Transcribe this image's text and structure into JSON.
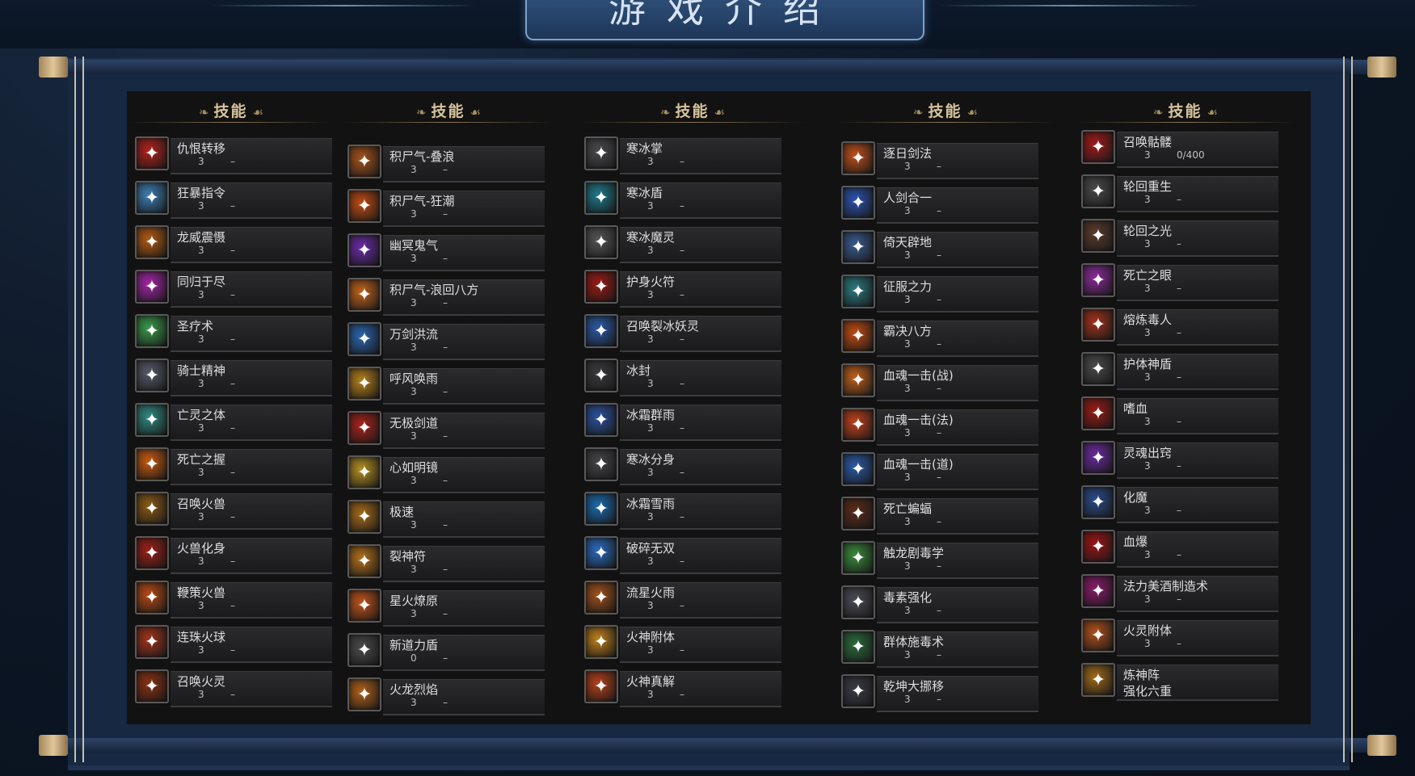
{
  "title": "游戏介绍",
  "column_header": "技能",
  "columns": [
    {
      "skills": [
        {
          "name": "仇恨转移",
          "level": "3",
          "progress": "–",
          "icon": "hatred-shift-icon",
          "color": "#b3201b"
        },
        {
          "name": "狂暴指令",
          "level": "3",
          "progress": "–",
          "icon": "berserk-command-icon",
          "color": "#3d7fb5"
        },
        {
          "name": "龙威震慑",
          "level": "3",
          "progress": "–",
          "icon": "dragon-roar-icon",
          "color": "#b35a12"
        },
        {
          "name": "同归于尽",
          "level": "3",
          "progress": "–",
          "icon": "mutual-destruction-icon",
          "color": "#a424a6"
        },
        {
          "name": "圣疗术",
          "level": "3",
          "progress": "–",
          "icon": "holy-heal-icon",
          "color": "#3a9a4a"
        },
        {
          "name": "骑士精神",
          "level": "3",
          "progress": "–",
          "icon": "knight-spirit-icon",
          "color": "#555a66"
        },
        {
          "name": "亡灵之体",
          "level": "3",
          "progress": "–",
          "icon": "undead-body-icon",
          "color": "#2f8a82"
        },
        {
          "name": "死亡之握",
          "level": "3",
          "progress": "–",
          "icon": "death-grip-icon",
          "color": "#c9590f"
        },
        {
          "name": "召唤火兽",
          "level": "3",
          "progress": "–",
          "icon": "summon-fire-beast-icon",
          "color": "#8c5a14"
        },
        {
          "name": "火兽化身",
          "level": "3",
          "progress": "–",
          "icon": "fire-beast-avatar-icon",
          "color": "#9c1f14"
        },
        {
          "name": "鞭策火兽",
          "level": "3",
          "progress": "–",
          "icon": "whip-fire-beast-icon",
          "color": "#b84a12"
        },
        {
          "name": "连珠火球",
          "level": "3",
          "progress": "–",
          "icon": "fireball-chain-icon",
          "color": "#a1321a"
        },
        {
          "name": "召唤火灵",
          "level": "3",
          "progress": "–",
          "icon": "summon-fire-spirit-icon",
          "color": "#8a3012"
        }
      ]
    },
    {
      "skills": [
        {
          "name": "积尸气-叠浪",
          "level": "3",
          "progress": "–",
          "icon": "corpse-qi-wave-icon",
          "color": "#a8521a"
        },
        {
          "name": "积尸气-狂潮",
          "level": "3",
          "progress": "–",
          "icon": "corpse-qi-tide-icon",
          "color": "#c04a12"
        },
        {
          "name": "幽冥鬼气",
          "level": "3",
          "progress": "–",
          "icon": "nether-ghost-qi-icon",
          "color": "#6a2aa8"
        },
        {
          "name": "积尸气-浪回八方",
          "level": "3",
          "progress": "–",
          "icon": "corpse-qi-eight-icon",
          "color": "#c0621a"
        },
        {
          "name": "万剑洪流",
          "level": "3",
          "progress": "–",
          "icon": "sword-torrent-icon",
          "color": "#2a64b0"
        },
        {
          "name": "呼风唤雨",
          "level": "3",
          "progress": "–",
          "icon": "summon-wind-rain-icon",
          "color": "#b5801a"
        },
        {
          "name": "无极剑道",
          "level": "3",
          "progress": "–",
          "icon": "infinite-sword-icon",
          "color": "#a8221a"
        },
        {
          "name": "心如明镜",
          "level": "3",
          "progress": "–",
          "icon": "clear-mind-icon",
          "color": "#b59020"
        },
        {
          "name": "极速",
          "level": "3",
          "progress": "–",
          "icon": "haste-icon",
          "color": "#a56a18"
        },
        {
          "name": "裂神符",
          "level": "3",
          "progress": "–",
          "icon": "rift-talisman-icon",
          "color": "#b5701a"
        },
        {
          "name": "星火燎原",
          "level": "3",
          "progress": "–",
          "icon": "starfire-icon",
          "color": "#c0521a"
        },
        {
          "name": "新道力盾",
          "level": "0",
          "progress": "–",
          "icon": "force-shield-icon",
          "color": "#4a4a4a"
        },
        {
          "name": "火龙烈焰",
          "level": "3",
          "progress": "–",
          "icon": "fire-dragon-flame-icon",
          "color": "#b0601a"
        }
      ]
    },
    {
      "skills": [
        {
          "name": "寒冰掌",
          "level": "3",
          "progress": "–",
          "icon": "ice-palm-icon",
          "color": "#4a4a4e"
        },
        {
          "name": "寒冰盾",
          "level": "3",
          "progress": "–",
          "icon": "ice-shield-icon",
          "color": "#1e7a8a"
        },
        {
          "name": "寒冰魔灵",
          "level": "3",
          "progress": "–",
          "icon": "ice-demon-icon",
          "color": "#555555"
        },
        {
          "name": "护身火符",
          "level": "3",
          "progress": "–",
          "icon": "fire-talisman-icon",
          "color": "#9a1a14"
        },
        {
          "name": "召唤裂冰妖灵",
          "level": "3",
          "progress": "–",
          "icon": "summon-ice-spirit-icon",
          "color": "#2a5aa8"
        },
        {
          "name": "冰封",
          "level": "3",
          "progress": "–",
          "icon": "freeze-icon",
          "color": "#3a3a3e"
        },
        {
          "name": "冰霜群雨",
          "level": "3",
          "progress": "–",
          "icon": "frost-rain-icon",
          "color": "#2a52a0"
        },
        {
          "name": "寒冰分身",
          "level": "3",
          "progress": "–",
          "icon": "ice-clone-icon",
          "color": "#444448"
        },
        {
          "name": "冰霜雪雨",
          "level": "3",
          "progress": "–",
          "icon": "frost-snow-icon",
          "color": "#1a6ab0"
        },
        {
          "name": "破碎无双",
          "level": "3",
          "progress": "–",
          "icon": "shatter-icon",
          "color": "#2a6ac0"
        },
        {
          "name": "流星火雨",
          "level": "3",
          "progress": "–",
          "icon": "meteor-rain-icon",
          "color": "#a0501a"
        },
        {
          "name": "火神附体",
          "level": "3",
          "progress": "–",
          "icon": "fire-god-possession-icon",
          "color": "#c0801a"
        },
        {
          "name": "火神真解",
          "level": "3",
          "progress": "–",
          "icon": "fire-god-truth-icon",
          "color": "#b5401a"
        }
      ]
    },
    {
      "skills": [
        {
          "name": "逐日剑法",
          "level": "3",
          "progress": "–",
          "icon": "sun-chasing-sword-icon",
          "color": "#c0501a"
        },
        {
          "name": "人剑合一",
          "level": "3",
          "progress": "–",
          "icon": "man-sword-unity-icon",
          "color": "#2a52b0"
        },
        {
          "name": "倚天辟地",
          "level": "3",
          "progress": "–",
          "icon": "heaven-split-icon",
          "color": "#3a5a90"
        },
        {
          "name": "征服之力",
          "level": "3",
          "progress": "–",
          "icon": "conquer-force-icon",
          "color": "#2a7a80"
        },
        {
          "name": "霸决八方",
          "level": "3",
          "progress": "–",
          "icon": "domination-icon",
          "color": "#c04a12"
        },
        {
          "name": "血魂一击(战)",
          "level": "3",
          "progress": "–",
          "icon": "blood-soul-warrior-icon",
          "color": "#c0601a"
        },
        {
          "name": "血魂一击(法)",
          "level": "3",
          "progress": "–",
          "icon": "blood-soul-mage-icon",
          "color": "#c0401a"
        },
        {
          "name": "血魂一击(道)",
          "level": "3",
          "progress": "–",
          "icon": "blood-soul-taoist-icon",
          "color": "#2a5aa8"
        },
        {
          "name": "死亡蝙蝠",
          "level": "3",
          "progress": "–",
          "icon": "death-bat-icon",
          "color": "#5a2a1a"
        },
        {
          "name": "触龙剧毒学",
          "level": "3",
          "progress": "–",
          "icon": "dragon-poison-icon",
          "color": "#3a8a3a"
        },
        {
          "name": "毒素强化",
          "level": "3",
          "progress": "–",
          "icon": "toxin-boost-icon",
          "color": "#4a4a55"
        },
        {
          "name": "群体施毒术",
          "level": "3",
          "progress": "–",
          "icon": "mass-poison-icon",
          "color": "#2a6a3a"
        },
        {
          "name": "乾坤大挪移",
          "level": "3",
          "progress": "–",
          "icon": "cosmos-shift-icon",
          "color": "#3a3a45"
        }
      ]
    },
    {
      "skills": [
        {
          "name": "召唤骷髅",
          "level": "3",
          "progress": "0/400",
          "icon": "summon-skeleton-icon",
          "color": "#a01a1a"
        },
        {
          "name": "轮回重生",
          "level": "3",
          "progress": "–",
          "icon": "reincarnation-icon",
          "color": "#4a4a4a"
        },
        {
          "name": "轮回之光",
          "level": "3",
          "progress": "–",
          "icon": "reincarnation-light-icon",
          "color": "#5a3a2a"
        },
        {
          "name": "死亡之眼",
          "level": "3",
          "progress": "–",
          "icon": "death-eye-icon",
          "color": "#8a2a9a"
        },
        {
          "name": "熔炼毒人",
          "level": "3",
          "progress": "–",
          "icon": "smelt-poison-icon",
          "color": "#a0301a"
        },
        {
          "name": "护体神盾",
          "level": "3",
          "progress": "–",
          "icon": "divine-shield-icon",
          "color": "#4a4a4a"
        },
        {
          "name": "嗜血",
          "level": "3",
          "progress": "–",
          "icon": "bloodthirst-icon",
          "color": "#9a1a14"
        },
        {
          "name": "灵魂出窍",
          "level": "3",
          "progress": "–",
          "icon": "soul-leave-icon",
          "color": "#6a2aa0"
        },
        {
          "name": "化魔",
          "level": "3",
          "progress": "–",
          "icon": "demonize-icon",
          "color": "#2a4a8a"
        },
        {
          "name": "血爆",
          "level": "3",
          "progress": "–",
          "icon": "blood-burst-icon",
          "color": "#9a1414"
        },
        {
          "name": "法力美酒制造术",
          "level": "3",
          "progress": "–",
          "icon": "mana-wine-icon",
          "color": "#8a1a6a"
        },
        {
          "name": "火灵附体",
          "level": "3",
          "progress": "–",
          "icon": "fire-spirit-possession-icon",
          "color": "#b0501a"
        },
        {
          "name": "炼神阵",
          "name2": "强化六重",
          "level": "",
          "progress": "",
          "icon": "spirit-array-icon",
          "color": "#a06a1a"
        }
      ]
    }
  ]
}
